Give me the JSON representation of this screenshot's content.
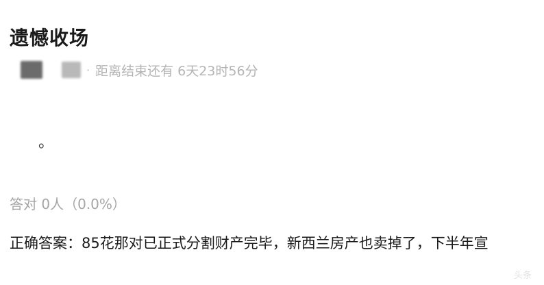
{
  "title": "遗憾收场",
  "meta": {
    "separator": "·",
    "countdown": "距离结束还有 6天23时56分"
  },
  "option_mark": "。",
  "stats": "答对  0人（0.0%）",
  "answer": "正确答案：85花那对已正式分割财产完毕，新西兰房产也卖掉了，下半年宣",
  "watermark": "头条"
}
